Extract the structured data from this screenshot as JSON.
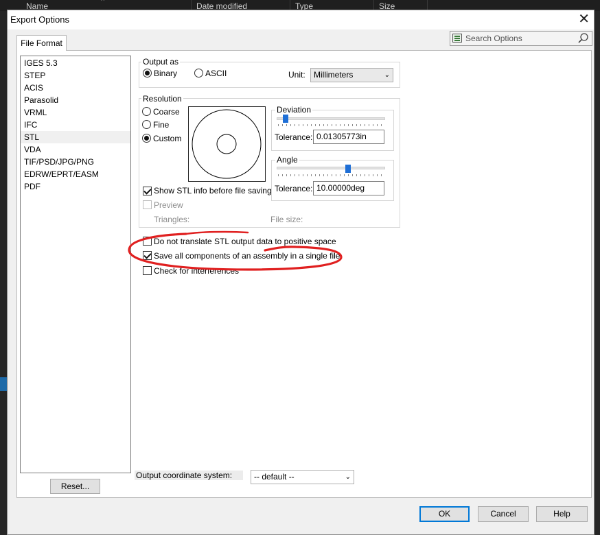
{
  "background": {
    "columns": [
      "Name",
      "Date modified",
      "Type",
      "Size"
    ]
  },
  "dialog": {
    "title": "Export Options",
    "tab": "File Format",
    "search_placeholder": "Search Options",
    "formats": [
      "IGES 5.3",
      "STEP",
      "ACIS",
      "Parasolid",
      "VRML",
      "IFC",
      "STL",
      "VDA",
      "TIF/PSD/JPG/PNG",
      "EDRW/EPRT/EASM",
      "PDF"
    ],
    "selected_format": "STL",
    "reset_label": "Reset...",
    "output_as": {
      "label": "Output as",
      "binary": "Binary",
      "ascii": "ASCII",
      "selected": "Binary",
      "unit_label": "Unit:",
      "unit_value": "Millimeters"
    },
    "resolution": {
      "label": "Resolution",
      "coarse": "Coarse",
      "fine": "Fine",
      "custom": "Custom",
      "selected": "Custom",
      "show_info_label": "Show STL info before file saving",
      "show_info_checked": true,
      "preview_label": "Preview",
      "preview_checked": false,
      "triangles_label": "Triangles:",
      "file_size_label": "File size:",
      "deviation": {
        "label": "Deviation",
        "tolerance_label": "Tolerance:",
        "tolerance_value": "0.01305773in",
        "slider_fraction": 0.08
      },
      "angle": {
        "label": "Angle",
        "tolerance_label": "Tolerance:",
        "tolerance_value": "10.00000deg",
        "slider_fraction": 0.66
      }
    },
    "options": [
      {
        "label": "Do not translate STL output data to positive space",
        "checked": false
      },
      {
        "label": "Save all components of an assembly in a single file",
        "checked": true
      },
      {
        "label": "Check for interferences",
        "checked": false
      }
    ],
    "coord_system_label": "Output coordinate system:",
    "coord_system_value": "-- default --",
    "buttons": {
      "ok": "OK",
      "cancel": "Cancel",
      "help": "Help"
    },
    "annotation_color": "#e02020"
  }
}
